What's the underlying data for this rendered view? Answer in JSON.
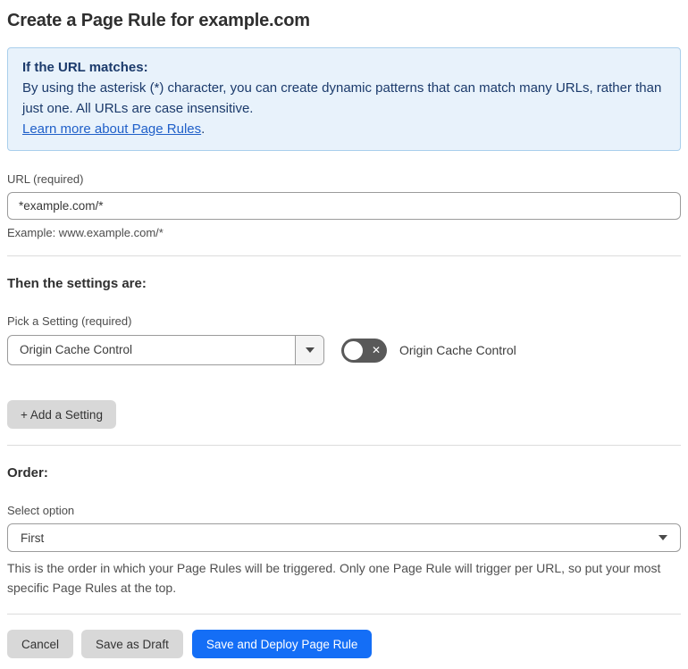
{
  "page": {
    "title": "Create a Page Rule for example.com"
  },
  "info_box": {
    "heading": "If the URL matches:",
    "body": "By using the asterisk (*) character, you can create dynamic patterns that can match many URLs, rather than just one. All URLs are case insensitive.",
    "link_label": "Learn more about Page Rules",
    "link_suffix": "."
  },
  "url_section": {
    "label": "URL (required)",
    "value": "*example.com/*",
    "example": "Example: www.example.com/*"
  },
  "settings_section": {
    "heading": "Then the settings are:",
    "picker_label": "Pick a Setting (required)",
    "picker_value": "Origin Cache Control",
    "toggle_label": "Origin Cache Control",
    "toggle_state": "off",
    "toggle_off_glyph": "✕",
    "add_setting_label": "+ Add a Setting"
  },
  "order_section": {
    "heading": "Order:",
    "select_label": "Select option",
    "select_value": "First",
    "help_text": "This is the order in which your Page Rules will be triggered. Only one Page Rule will trigger per URL, so put your most specific Page Rules at the top."
  },
  "footer": {
    "cancel_label": "Cancel",
    "save_draft_label": "Save as Draft",
    "save_deploy_label": "Save and Deploy Page Rule"
  },
  "colors": {
    "accent_blue": "#146ef6",
    "info_background": "#e8f2fb",
    "info_border": "#a9cfec",
    "info_text": "#1b3a6b",
    "link_blue": "#2060c9",
    "toggle_off_background": "#595959",
    "gray_button_background": "#d8d8d8"
  }
}
